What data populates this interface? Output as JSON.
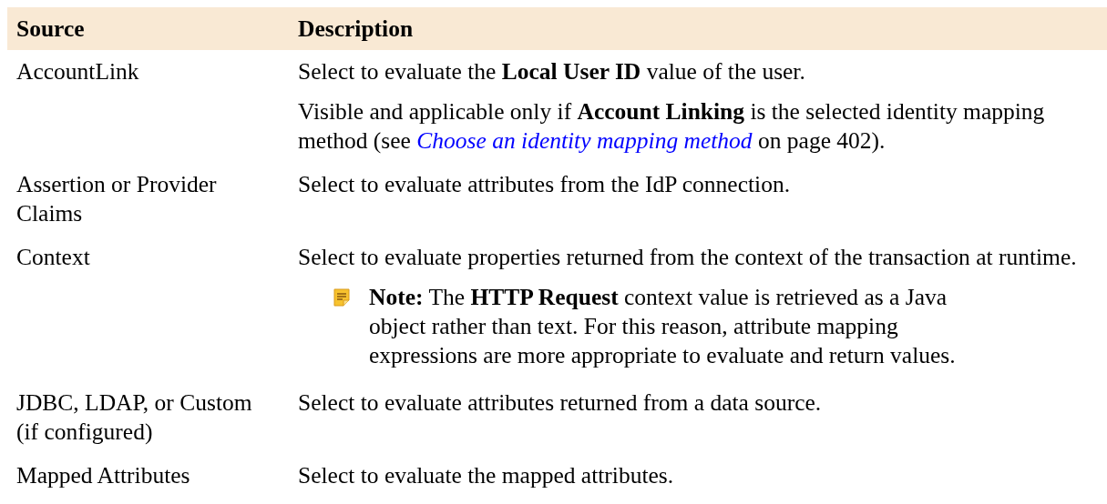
{
  "table": {
    "columns": [
      "Source",
      "Description"
    ],
    "rows": [
      {
        "source": "AccountLink",
        "paragraphs": [
          {
            "kind": "text",
            "parts": [
              {
                "kind": "text",
                "text": "Select to evaluate the **Local User ID** value of the user."
              }
            ]
          },
          {
            "kind": "text",
            "parts": [
              {
                "kind": "text",
                "text": "Visible and applicable only if **Account Linking** is the selected identity mapping method (see "
              },
              {
                "kind": "link",
                "text": "Choose an identity mapping method"
              },
              {
                "kind": "text",
                "text": " on page 402)."
              }
            ]
          }
        ]
      },
      {
        "source": "Assertion or Provider Claims",
        "paragraphs": [
          {
            "kind": "text",
            "parts": [
              {
                "kind": "text",
                "text": "Select to evaluate attributes from the IdP connection."
              }
            ]
          }
        ]
      },
      {
        "source": "Context",
        "paragraphs": [
          {
            "kind": "text",
            "parts": [
              {
                "kind": "text",
                "text": "Select to evaluate properties returned from the context of the transaction at runtime."
              }
            ]
          },
          {
            "kind": "note",
            "parts": [
              {
                "kind": "text",
                "text": "**Note:**  The **HTTP Request** context value is retrieved as a Java object rather than text. For this reason, attribute mapping expressions are more appropriate to evaluate and return values."
              }
            ]
          }
        ]
      },
      {
        "source": "JDBC, LDAP, or Custom (if configured)",
        "paragraphs": [
          {
            "kind": "text",
            "parts": [
              {
                "kind": "text",
                "text": "Select to evaluate attributes returned from a data source."
              }
            ]
          }
        ]
      },
      {
        "source": "Mapped Attributes",
        "paragraphs": [
          {
            "kind": "text",
            "parts": [
              {
                "kind": "text",
                "text": "Select to evaluate the mapped attributes."
              }
            ]
          }
        ]
      }
    ]
  }
}
